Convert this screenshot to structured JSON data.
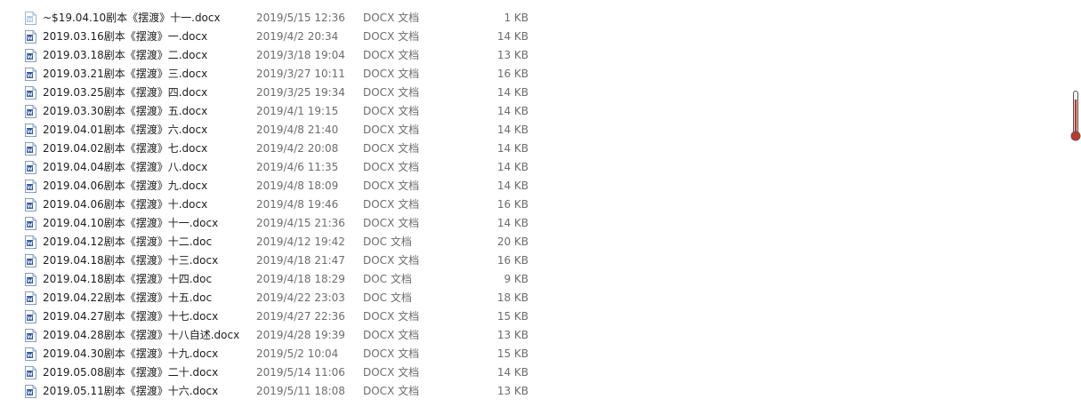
{
  "files": [
    {
      "name": "~$19.04.10剧本《摆渡》十一.docx",
      "date": "2019/5/15 12:36",
      "type": "DOCX 文档",
      "size": "1 KB",
      "icon": "temp-word-document-icon"
    },
    {
      "name": "2019.03.16剧本《摆渡》一.docx",
      "date": "2019/4/2 20:34",
      "type": "DOCX 文档",
      "size": "14 KB",
      "icon": "word-document-icon"
    },
    {
      "name": "2019.03.18剧本《摆渡》二.docx",
      "date": "2019/3/18 19:04",
      "type": "DOCX 文档",
      "size": "13 KB",
      "icon": "word-document-icon"
    },
    {
      "name": "2019.03.21剧本《摆渡》三.docx",
      "date": "2019/3/27 10:11",
      "type": "DOCX 文档",
      "size": "16 KB",
      "icon": "word-document-icon"
    },
    {
      "name": "2019.03.25剧本《摆渡》四.docx",
      "date": "2019/3/25 19:34",
      "type": "DOCX 文档",
      "size": "14 KB",
      "icon": "word-document-icon"
    },
    {
      "name": "2019.03.30剧本《摆渡》五.docx",
      "date": "2019/4/1 19:15",
      "type": "DOCX 文档",
      "size": "14 KB",
      "icon": "word-document-icon"
    },
    {
      "name": "2019.04.01剧本《摆渡》六.docx",
      "date": "2019/4/8 21:40",
      "type": "DOCX 文档",
      "size": "14 KB",
      "icon": "word-document-icon"
    },
    {
      "name": "2019.04.02剧本《摆渡》七.docx",
      "date": "2019/4/2 20:08",
      "type": "DOCX 文档",
      "size": "14 KB",
      "icon": "word-document-icon"
    },
    {
      "name": "2019.04.04剧本《摆渡》八.docx",
      "date": "2019/4/6 11:35",
      "type": "DOCX 文档",
      "size": "14 KB",
      "icon": "word-document-icon"
    },
    {
      "name": "2019.04.06剧本《摆渡》九.docx",
      "date": "2019/4/8 18:09",
      "type": "DOCX 文档",
      "size": "14 KB",
      "icon": "word-document-icon"
    },
    {
      "name": "2019.04.06剧本《摆渡》十.docx",
      "date": "2019/4/8 19:46",
      "type": "DOCX 文档",
      "size": "16 KB",
      "icon": "word-document-icon"
    },
    {
      "name": "2019.04.10剧本《摆渡》十一.docx",
      "date": "2019/4/15 21:36",
      "type": "DOCX 文档",
      "size": "14 KB",
      "icon": "word-document-icon"
    },
    {
      "name": "2019.04.12剧本《摆渡》十二.doc",
      "date": "2019/4/12 19:42",
      "type": "DOC 文档",
      "size": "20 KB",
      "icon": "word-document-icon"
    },
    {
      "name": "2019.04.18剧本《摆渡》十三.docx",
      "date": "2019/4/18 21:47",
      "type": "DOCX 文档",
      "size": "16 KB",
      "icon": "word-document-icon"
    },
    {
      "name": "2019.04.18剧本《摆渡》十四.doc",
      "date": "2019/4/18 18:29",
      "type": "DOC 文档",
      "size": "9 KB",
      "icon": "word-document-icon"
    },
    {
      "name": "2019.04.22剧本《摆渡》十五.doc",
      "date": "2019/4/22 23:03",
      "type": "DOC 文档",
      "size": "18 KB",
      "icon": "word-document-icon"
    },
    {
      "name": "2019.04.27剧本《摆渡》十七.docx",
      "date": "2019/4/27 22:36",
      "type": "DOCX 文档",
      "size": "15 KB",
      "icon": "word-document-icon"
    },
    {
      "name": "2019.04.28剧本《摆渡》十八自述.docx",
      "date": "2019/4/28 19:39",
      "type": "DOCX 文档",
      "size": "13 KB",
      "icon": "word-document-icon"
    },
    {
      "name": "2019.04.30剧本《摆渡》十九.docx",
      "date": "2019/5/2 10:04",
      "type": "DOCX 文档",
      "size": "15 KB",
      "icon": "word-document-icon"
    },
    {
      "name": "2019.05.08剧本《摆渡》二十.docx",
      "date": "2019/5/14 11:06",
      "type": "DOCX 文档",
      "size": "14 KB",
      "icon": "word-document-icon"
    },
    {
      "name": "2019.05.11剧本《摆渡》十六.docx",
      "date": "2019/5/11 18:08",
      "type": "DOCX 文档",
      "size": "13 KB",
      "icon": "word-document-icon"
    }
  ],
  "colors": {
    "doc_icon_blue": "#2b579a",
    "temp_icon_blue": "#8fb2dc",
    "thermometer_red": "#c0392b"
  }
}
